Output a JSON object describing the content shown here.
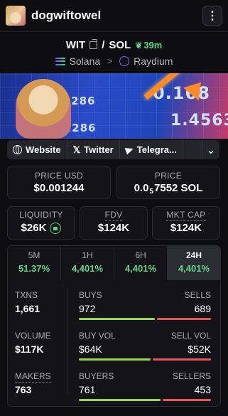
{
  "header": {
    "title": "dogwiftowel",
    "menu_icon": "vertical-dots-icon"
  },
  "pair": {
    "base": "WIT",
    "separator": "/",
    "quote": "SOL",
    "age": "39m"
  },
  "chain": {
    "network": "Solana",
    "dex": "Raydium"
  },
  "banner": {
    "num1": "0.168",
    "num2": "2.286",
    "num3": "2.286",
    "num4": "1.4563"
  },
  "links": {
    "website": "Website",
    "twitter": "Twitter",
    "telegram": "Telegra..."
  },
  "price": {
    "usd_label": "PRICE USD",
    "usd_value": "$0.001244",
    "sol_label": "PRICE",
    "sol_prefix": "0.0",
    "sol_zeros": "5",
    "sol_suffix": "7552 SOL"
  },
  "metrics": {
    "liquidity_label": "LIQUIDITY",
    "liquidity_value": "$26K",
    "fdv_label": "FDV",
    "fdv_value": "$124K",
    "mktcap_label": "MKT CAP",
    "mktcap_value": "$124K"
  },
  "timeframes": [
    {
      "label": "5M",
      "change": "51.37%"
    },
    {
      "label": "1H",
      "change": "4,401%"
    },
    {
      "label": "6H",
      "change": "4,401%"
    },
    {
      "label": "24H",
      "change": "4,401%",
      "active": true
    }
  ],
  "stats": {
    "txns_label": "TXNS",
    "txns_value": "1,661",
    "volume_label": "VOLUME",
    "volume_value": "$117K",
    "makers_label": "MAKERS",
    "makers_value": "763",
    "buys_label": "BUYS",
    "buys_value": "972",
    "sells_label": "SELLS",
    "sells_value": "689",
    "buyvol_label": "BUY VOL",
    "buyvol_value": "$64K",
    "sellvol_label": "SELL VOL",
    "sellvol_value": "$52K",
    "buyers_label": "BUYERS",
    "buyers_value": "761",
    "sellers_label": "SELLERS",
    "sellers_value": "453"
  },
  "colors": {
    "positive": "#5fd38d",
    "buy_bar": "#9ad84a",
    "sell_bar": "#e8545e",
    "background": "#0e0e11"
  }
}
